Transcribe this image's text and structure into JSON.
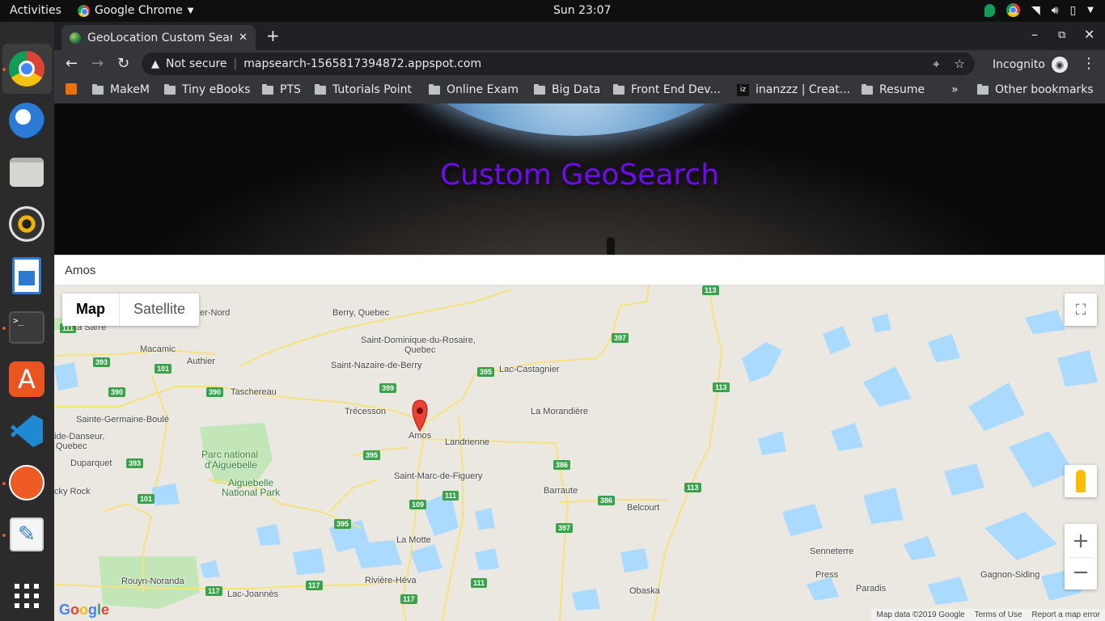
{
  "topbar": {
    "activities": "Activities",
    "app_name": "Google Chrome",
    "clock": "Sun 23:07"
  },
  "dock": {
    "items": [
      "chrome-icon",
      "thunderbird-icon",
      "files-icon",
      "rhythmbox-icon",
      "writer-icon",
      "terminal-icon",
      "software-icon",
      "vscode-icon",
      "postman-icon",
      "text-editor-icon",
      "show-apps-icon"
    ]
  },
  "browser": {
    "tab_title": "GeoLocation Custom Sear",
    "security": "Not secure",
    "url": "mapsearch-1565817394872.appspot.com",
    "incognito": "Incognito",
    "bookmarks": [
      "MakeM",
      "Tiny eBooks",
      "PTS",
      "Tutorials Point",
      "Online Exam",
      "Big Data",
      "Front End Dev...",
      "inanzzz | Creat...",
      "Resume"
    ],
    "other_bookmarks": "Other bookmarks",
    "overflow": "»"
  },
  "page": {
    "banner_title": "Custom GeoSearch",
    "search_value": "Amos"
  },
  "map": {
    "type_map": "Map",
    "type_satellite": "Satellite",
    "labels": {
      "berry": "Berry, Quebec",
      "nord": "er-Nord",
      "lasarre": "La Sarre",
      "stdom": "Saint-Dominique-du-Rosaire,",
      "stdom2": "Quebec",
      "macamic": "Macamic",
      "authier": "Authier",
      "stnaz": "Saint-Nazaire-de-Berry",
      "lacast": "Lac-Castagnier",
      "taschereau": "Taschereau",
      "trecesson": "Trécesson",
      "lamorandiere": "La Morandière",
      "stgermaine": "Sainte-Germaine-Boulé",
      "amos": "Amos",
      "landrienne": "Landrienne",
      "danseur": "ide-Danseur,",
      "danseur2": "Quebec",
      "duparquet": "Duparquet",
      "park1": "Parc national",
      "park2": "d'Aiguebelle",
      "park3": "Aiguebelle",
      "park4": "National Park",
      "stmarc": "Saint-Marc-de-Figuery",
      "rock": "cky Rock",
      "barraute": "Barraute",
      "belcourt": "Belcourt",
      "lamotte": "La Motte",
      "senneterre": "Senneterre",
      "press": "Press",
      "paradis": "Paradis",
      "gagnon": "Gagnon-Siding",
      "rouyn": "Rouyn-Noranda",
      "riviere": "Rivière-Héva",
      "lacjoannes": "Lac-Joannès",
      "obaska": "Obaska"
    },
    "shields": {
      "s113a": "113",
      "s111a": "111",
      "s397a": "397",
      "s393a": "393",
      "s101a": "101",
      "s395a": "395",
      "s390a": "390",
      "s390b": "390",
      "s399": "399",
      "s113b": "113",
      "s395b": "395",
      "s393b": "393",
      "s386a": "386",
      "s101b": "101",
      "s111b": "111",
      "s113c": "113",
      "s109": "109",
      "s386b": "386",
      "s395c": "395",
      "s397b": "397",
      "s117a": "117",
      "s117b": "117",
      "s111c": "111",
      "s117c": "117"
    },
    "google_logo": "Google",
    "attribution": {
      "data": "Map data ©2019 Google",
      "terms": "Terms of Use",
      "report": "Report a map error"
    },
    "colors": {
      "water": "#aadaff",
      "park": "#c3e6b8",
      "road": "#f6e27a",
      "land": "#ebe8e2",
      "marker": "#ea4335"
    }
  }
}
